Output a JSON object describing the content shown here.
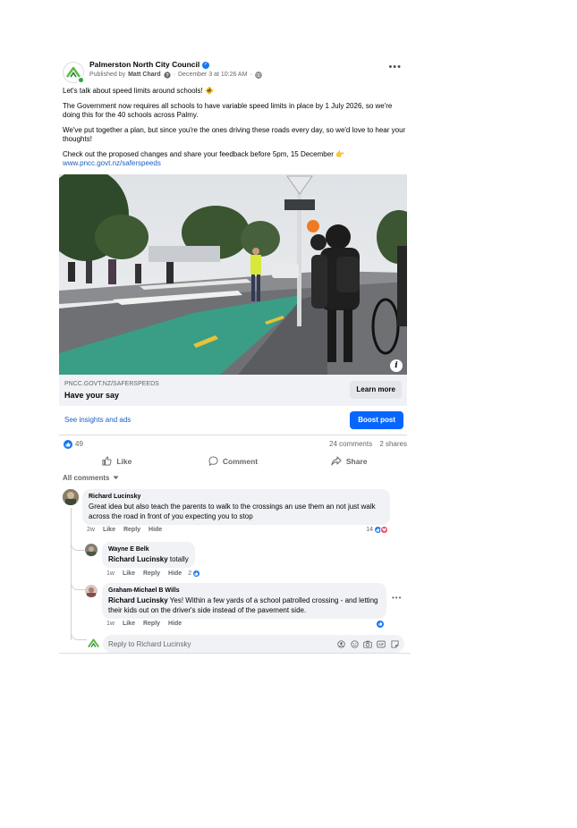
{
  "post": {
    "page_name": "Palmerston North City Council",
    "published_by_prefix": "Published by",
    "publisher": "Matt Chard",
    "date": "December 3 at 10:26 AM",
    "separator": "·",
    "more_label": "•••",
    "paragraphs": [
      "Let's talk about speed limits around schools! 🚸",
      "The Government now requires all schools to have variable speed limits in place by 1 July 2026, so we're doing this for the 40 schools across Palmy.",
      "We've put together a plan, but since you're the ones driving these roads every day, so we'd love to hear your thoughts!",
      "Check out the proposed changes and share your feedback before 5pm, 15 December 👉"
    ],
    "link_url": "www.pncc.govt.nz/saferspeeds"
  },
  "link_preview": {
    "domain": "PNCC.GOVT.NZ/SAFERSPEEDS",
    "title": "Have your say",
    "cta": "Learn more",
    "info_icon": "i"
  },
  "insights": {
    "link": "See insights and ads",
    "boost": "Boost post"
  },
  "stats": {
    "likes": "49",
    "comments": "24 comments",
    "shares": "2 shares"
  },
  "actions": {
    "like": "Like",
    "comment": "Comment",
    "share": "Share"
  },
  "comments_filter": "All comments",
  "comments": [
    {
      "author": "Richard Lucinsky",
      "text": "Great idea but also teach the parents to walk to the crossings an use them an not just walk across the road in front of you expecting you to stop",
      "time": "2w",
      "like": "Like",
      "reply": "Reply",
      "hide": "Hide",
      "reactions": "14"
    }
  ],
  "replies": [
    {
      "author": "Wayne E Belk",
      "mention": "Richard Lucinsky",
      "text": " totally",
      "time": "1w",
      "like": "Like",
      "reply": "Reply",
      "hide": "Hide",
      "reactions": "2"
    },
    {
      "author": "Graham-Michael B Wills",
      "mention": "Richard Lucinsky",
      "text": " Yes! Within a few yards of a school patrolled crossing - and letting their kids out on the driver's side instead of the pavement side.",
      "time": "1w",
      "like": "Like",
      "reply": "Reply",
      "hide": "Hide",
      "more_label": "•••"
    }
  ],
  "reply_box": {
    "placeholder": "Reply to Richard Lucinsky"
  },
  "colors": {
    "facebook_blue": "#0866ff",
    "link_blue": "#1b5fc1",
    "muted_text": "#65676b",
    "bubble_bg": "#f0f2f5",
    "brand_green": "#4caf50"
  }
}
